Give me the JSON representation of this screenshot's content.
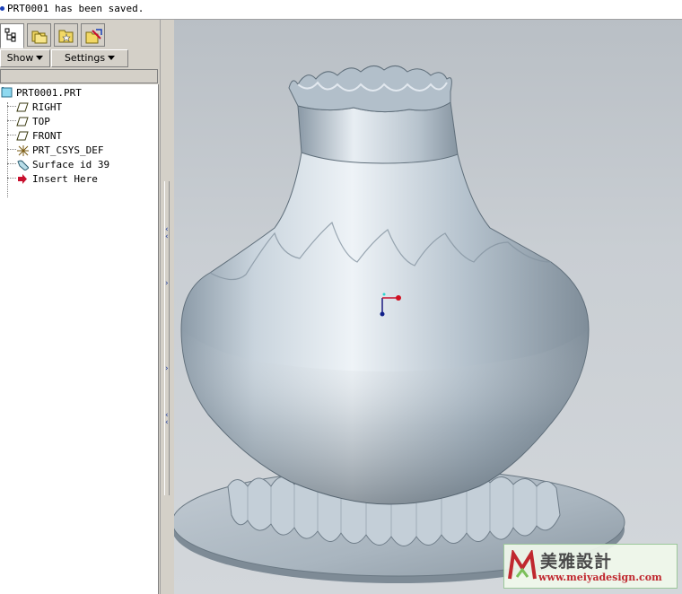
{
  "message_bar": {
    "text": "PRT0001 has been saved."
  },
  "tabs": [
    {
      "name": "model-tree-icon",
      "active": true
    },
    {
      "name": "folder-browser-icon",
      "active": false
    },
    {
      "name": "favorites-icon",
      "active": false
    },
    {
      "name": "connections-icon",
      "active": false
    }
  ],
  "toolbar": {
    "show_label": "Show",
    "settings_label": "Settings"
  },
  "tree": {
    "root": {
      "label": "PRT0001.PRT",
      "icon": "part-icon"
    },
    "items": [
      {
        "label": "RIGHT",
        "icon": "datum-plane-icon"
      },
      {
        "label": "TOP",
        "icon": "datum-plane-icon"
      },
      {
        "label": "FRONT",
        "icon": "datum-plane-icon"
      },
      {
        "label": "PRT_CSYS_DEF",
        "icon": "csys-icon"
      },
      {
        "label": "Surface id 39",
        "icon": "surface-icon"
      },
      {
        "label": "Insert Here",
        "icon": "insert-arrow-icon"
      }
    ]
  },
  "watermark": {
    "title": "美雅設計",
    "url": "www.meiyadesign.com"
  },
  "colors": {
    "surface": "#a9b8c4",
    "highlight": "#eef3f7",
    "shadow": "#5f6e7a",
    "background": "#c6cbd0",
    "insert_arrow": "#c8102e"
  }
}
